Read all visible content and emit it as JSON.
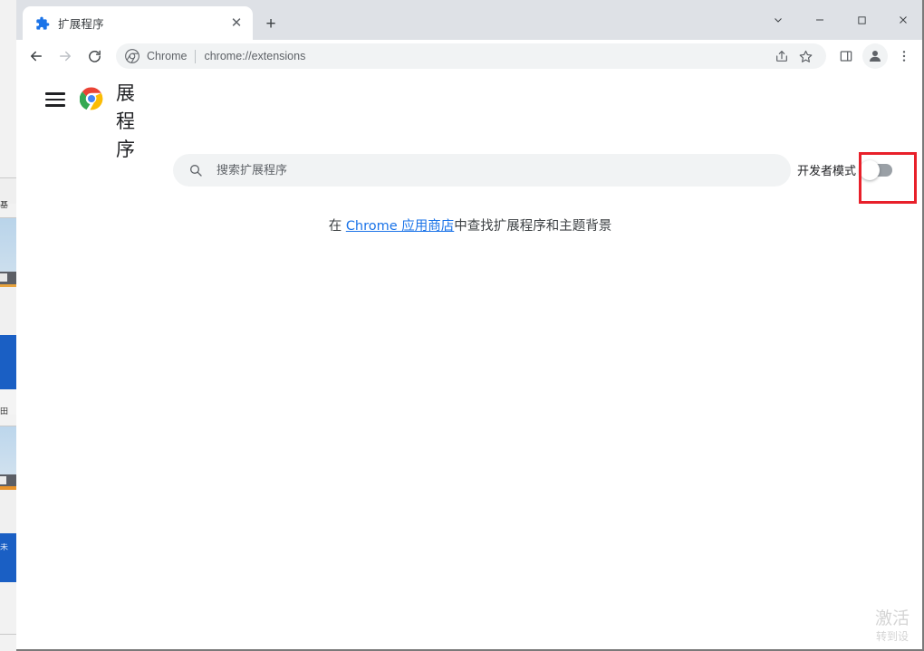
{
  "window": {
    "controls": {
      "tab_search": "tab-search-chevron",
      "minimize": "—",
      "maximize": "☐",
      "close": "✕"
    }
  },
  "tabstrip": {
    "tabs": [
      {
        "title": "扩展程序",
        "favicon": "puzzle-piece-icon",
        "close_label": "✕",
        "active": true
      }
    ],
    "new_tab_label": "+"
  },
  "toolbar": {
    "back_label": "back-arrow-icon",
    "forward_label": "forward-arrow-icon",
    "reload_label": "reload-icon",
    "omnibox": {
      "site_icon": "chrome-icon",
      "scheme_chip": "Chrome",
      "url": "chrome://extensions",
      "share_icon": "share-icon",
      "bookmark_icon": "star-icon"
    },
    "side_panel_icon": "side-panel-icon",
    "profile_icon": "profile-avatar-icon",
    "menu_icon": "three-dot-menu-icon"
  },
  "extensions_page": {
    "menu_button_label": "hamburger-menu-icon",
    "logo": "chrome-logo",
    "title": "展程序",
    "search": {
      "placeholder": "搜索扩展程序",
      "value": "",
      "icon": "search-icon"
    },
    "developer_mode": {
      "label": "开发者模式",
      "enabled": false
    },
    "empty_state": {
      "prefix": "在 ",
      "link_text": "Chrome 应用商店",
      "suffix": "中查找扩展程序和主题背景"
    }
  },
  "watermark": {
    "line1": "激活",
    "line2": "转到设"
  },
  "colors": {
    "tabstrip_bg": "#dee1e6",
    "link": "#1a73e8",
    "highlight": "#e8202a",
    "toggle_track": "#9aa0a6",
    "field_bg": "#f1f3f4"
  }
}
